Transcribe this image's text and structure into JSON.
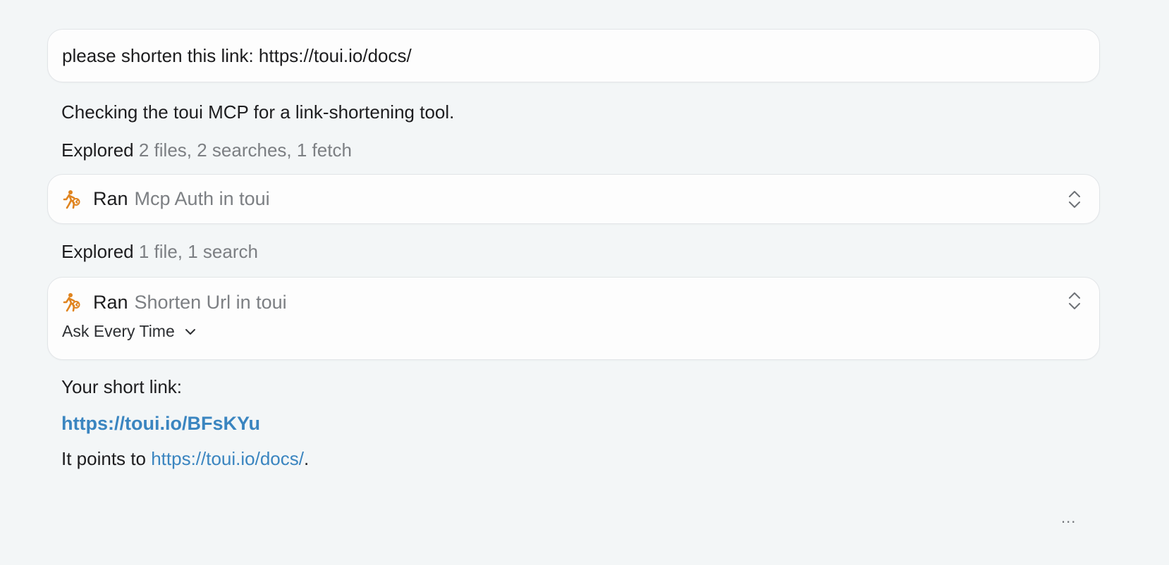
{
  "user_message": "please shorten this link: https://toui.io/docs/",
  "assistant": {
    "intro": "Checking the toui MCP for a link-shortening tool.",
    "explored1": {
      "label": "Explored",
      "detail": "2 files, 2 searches, 1 fetch"
    },
    "tool1": {
      "verb": "Ran",
      "name": "Mcp Auth in toui",
      "icon": "runner-icon"
    },
    "explored2": {
      "label": "Explored",
      "detail": "1 file, 1 search"
    },
    "tool2": {
      "verb": "Ran",
      "name": "Shorten Url in toui",
      "icon": "runner-icon",
      "permission": "Ask Every Time"
    },
    "short_link_label": "Your short link:",
    "short_link": "https://toui.io/BFsKYu",
    "points_prefix": "It points to",
    "points_link": "https://toui.io/docs/",
    "points_suffix": "."
  },
  "more_menu": "...",
  "colors": {
    "background": "#f3f6f7",
    "link": "#3a85c0",
    "icon_orange": "#e0841f",
    "muted": "#7c7f83"
  }
}
